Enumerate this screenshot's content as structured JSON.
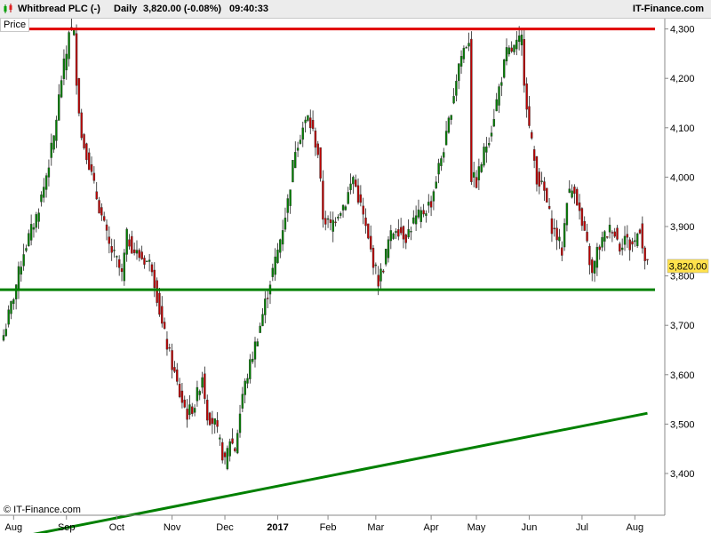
{
  "header": {
    "instrument": "Whitbread PLC (-)",
    "period": "Daily",
    "quote": "3,820.00 (-0.08%)",
    "time": "09:40:33",
    "brand": "IT-Finance.com",
    "panel_tab": "Price"
  },
  "watermark": "© IT-Finance.com",
  "colors": {
    "candle_up": "#008000",
    "candle_down": "#c00000",
    "resistance": "#e00000",
    "support": "#008000",
    "last_price_box": "#ffe24c"
  },
  "chart_data": {
    "type": "candlestick",
    "ylim": [
      3300,
      4440
    ],
    "y_ticks": [
      3400,
      3500,
      3600,
      3700,
      3800,
      3900,
      4000,
      4100,
      4200,
      4300,
      4400
    ],
    "y_tick_labels": [
      "3,400",
      "3,500",
      "3,600",
      "3,700",
      "3,800",
      "3,900",
      "4,000",
      "4,100",
      "4,200",
      "4,300",
      "4,400"
    ],
    "x_tick_labels": [
      {
        "label": "Aug",
        "bar": 4
      },
      {
        "label": "Sep",
        "bar": 25
      },
      {
        "label": "Oct",
        "bar": 45
      },
      {
        "label": "Nov",
        "bar": 67
      },
      {
        "label": "Dec",
        "bar": 88
      },
      {
        "label": "2017",
        "bar": 109,
        "bold": true
      },
      {
        "label": "Feb",
        "bar": 129
      },
      {
        "label": "Mar",
        "bar": 148
      },
      {
        "label": "Apr",
        "bar": 170
      },
      {
        "label": "May",
        "bar": 188
      },
      {
        "label": "Jun",
        "bar": 209
      },
      {
        "label": "Jul",
        "bar": 230
      },
      {
        "label": "Aug",
        "bar": 251
      }
    ],
    "last_price": "3,820.00",
    "last_price_value": 3820,
    "anchors": [
      [
        0,
        3680
      ],
      [
        4,
        3760
      ],
      [
        8,
        3850
      ],
      [
        13,
        3920
      ],
      [
        16,
        3980
      ],
      [
        20,
        4080
      ],
      [
        23,
        4200
      ],
      [
        25,
        4250
      ],
      [
        26,
        4300
      ],
      [
        28,
        4290
      ],
      [
        29,
        4200
      ],
      [
        31,
        4080
      ],
      [
        33,
        4050
      ],
      [
        36,
        3980
      ],
      [
        40,
        3900
      ],
      [
        42,
        3860
      ],
      [
        45,
        3830
      ],
      [
        47,
        3800
      ],
      [
        49,
        3880
      ],
      [
        52,
        3850
      ],
      [
        54,
        3840
      ],
      [
        57,
        3830
      ],
      [
        59,
        3820
      ],
      [
        61,
        3760
      ],
      [
        63,
        3700
      ],
      [
        65,
        3660
      ],
      [
        67,
        3620
      ],
      [
        70,
        3560
      ],
      [
        73,
        3520
      ],
      [
        76,
        3540
      ],
      [
        79,
        3600
      ],
      [
        81,
        3520
      ],
      [
        84,
        3500
      ],
      [
        86,
        3460
      ],
      [
        88,
        3420
      ],
      [
        90,
        3470
      ],
      [
        92,
        3450
      ],
      [
        95,
        3560
      ],
      [
        99,
        3640
      ],
      [
        102,
        3700
      ],
      [
        106,
        3790
      ],
      [
        109,
        3850
      ],
      [
        113,
        3950
      ],
      [
        116,
        4060
      ],
      [
        119,
        4100
      ],
      [
        121,
        4120
      ],
      [
        123,
        4090
      ],
      [
        125,
        4050
      ],
      [
        127,
        3920
      ],
      [
        130,
        3900
      ],
      [
        133,
        3930
      ],
      [
        136,
        3950
      ],
      [
        139,
        4000
      ],
      [
        141,
        3960
      ],
      [
        143,
        3920
      ],
      [
        145,
        3870
      ],
      [
        147,
        3830
      ],
      [
        149,
        3790
      ],
      [
        151,
        3820
      ],
      [
        153,
        3870
      ],
      [
        156,
        3900
      ],
      [
        160,
        3880
      ],
      [
        163,
        3910
      ],
      [
        167,
        3930
      ],
      [
        170,
        3950
      ],
      [
        173,
        4020
      ],
      [
        176,
        4080
      ],
      [
        179,
        4170
      ],
      [
        181,
        4230
      ],
      [
        183,
        4260
      ],
      [
        185,
        4280
      ],
      [
        186,
        4000
      ],
      [
        188,
        3990
      ],
      [
        191,
        4050
      ],
      [
        194,
        4100
      ],
      [
        197,
        4180
      ],
      [
        200,
        4250
      ],
      [
        203,
        4260
      ],
      [
        206,
        4280
      ],
      [
        207,
        4200
      ],
      [
        209,
        4100
      ],
      [
        212,
        4000
      ],
      [
        215,
        3970
      ],
      [
        218,
        3900
      ],
      [
        220,
        3880
      ],
      [
        222,
        3850
      ],
      [
        224,
        3960
      ],
      [
        227,
        3980
      ],
      [
        230,
        3900
      ],
      [
        232,
        3860
      ],
      [
        234,
        3800
      ],
      [
        236,
        3850
      ],
      [
        239,
        3880
      ],
      [
        242,
        3900
      ],
      [
        245,
        3860
      ],
      [
        247,
        3880
      ],
      [
        249,
        3860
      ],
      [
        251,
        3870
      ],
      [
        253,
        3900
      ],
      [
        255,
        3830
      ],
      [
        256,
        3820
      ]
    ],
    "lines": [
      {
        "kind": "horizontal",
        "role": "resistance",
        "value": 4300
      },
      {
        "kind": "horizontal",
        "role": "support",
        "value": 3772
      },
      {
        "kind": "trend",
        "role": "support",
        "from": {
          "bar": 0,
          "value": 3265
        },
        "to": {
          "bar": 256,
          "value": 3522
        }
      }
    ]
  }
}
